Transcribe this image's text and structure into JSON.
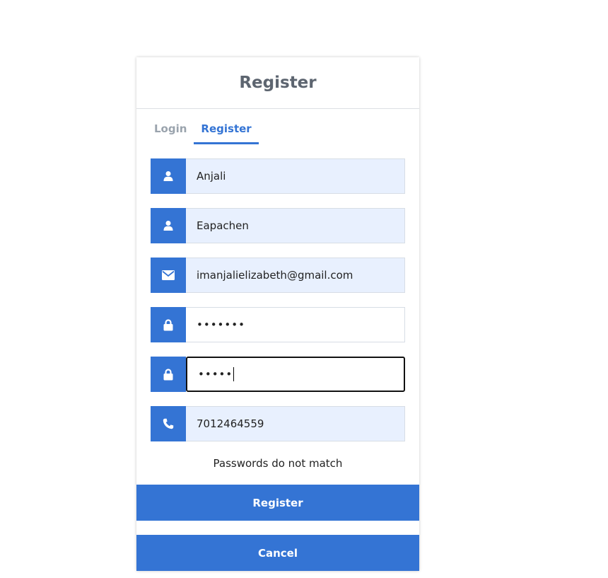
{
  "header": {
    "title": "Register"
  },
  "tabs": [
    {
      "label": "Login",
      "active": false
    },
    {
      "label": "Register",
      "active": true
    }
  ],
  "fields": {
    "first_name": {
      "value": "Anjali",
      "icon": "user-icon"
    },
    "last_name": {
      "value": "Eapachen",
      "icon": "user-icon"
    },
    "email": {
      "value": "imanjalielizabeth@gmail.com",
      "icon": "envelope-icon"
    },
    "password": {
      "value": "•••••••",
      "icon": "lock-icon"
    },
    "confirm_password": {
      "value": "•••••",
      "icon": "lock-icon"
    },
    "phone": {
      "value": "7012464559",
      "icon": "phone-icon"
    }
  },
  "message": "Passwords do not match",
  "buttons": {
    "register": "Register",
    "cancel": "Cancel"
  },
  "colors": {
    "accent": "#3474d4",
    "title": "#5d6570",
    "autofill_bg": "#e8f0fe"
  }
}
